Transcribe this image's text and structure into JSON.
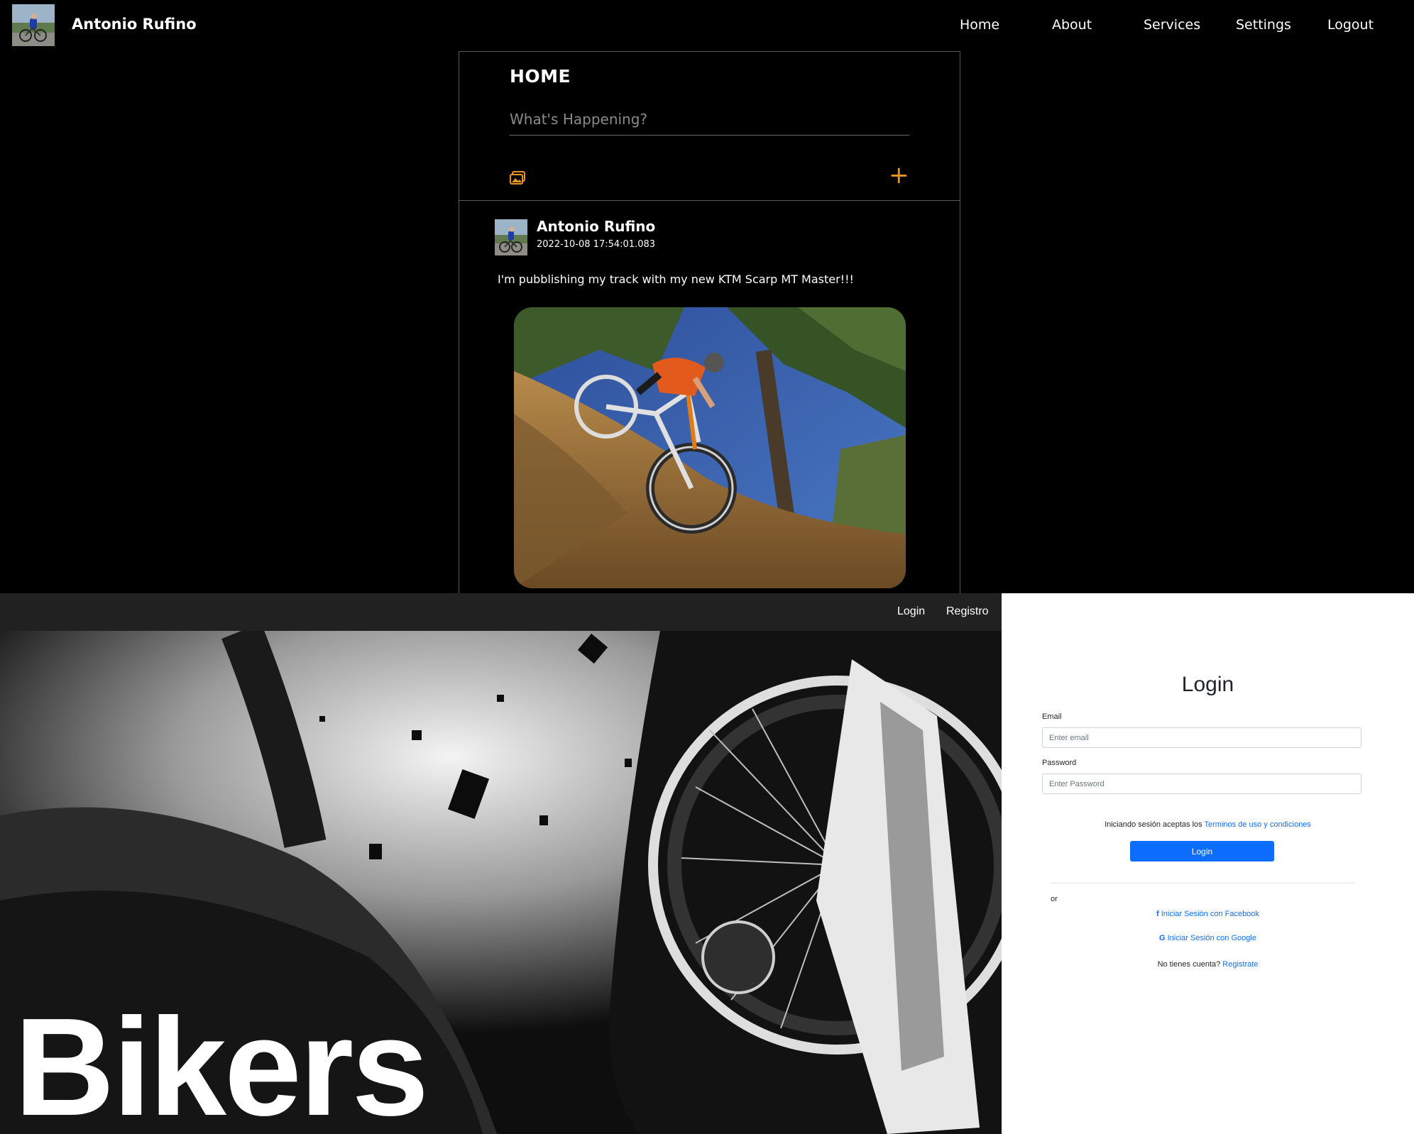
{
  "app": {
    "brand_name": "Antonio Rufino",
    "nav": [
      "Home",
      "About",
      "Services",
      "Settings",
      "Logout"
    ],
    "home_title": "HOME",
    "compose_placeholder": "What's Happening?",
    "add_symbol": "+",
    "accent_color": "#e8961e",
    "post": {
      "author": "Antonio Rufino",
      "timestamp": "2022-10-08 17:54:01.083",
      "text": "I'm pubblishing my track with my new KTM Scarp MT Master!!!"
    }
  },
  "hero": {
    "nav": [
      "Login",
      "Registro"
    ],
    "title": "Bikers"
  },
  "login": {
    "title": "Login",
    "email_label": "Email",
    "email_placeholder": "Enter email",
    "password_label": "Password",
    "password_placeholder": "Enter Password",
    "terms_prefix": "Iniciando sesión aceptas los",
    "terms_link": "Terminos de uso y condiciones",
    "submit_label": "Login",
    "or": "or",
    "facebook_icon": "f",
    "facebook_label": "Iniciar Sesión con Facebook",
    "google_icon": "G",
    "google_label": "Iniciar Sesión con Google",
    "signup_prefix": "No tienes cuenta?",
    "signup_link": "Registrate",
    "primary_color": "#0d6efd"
  }
}
